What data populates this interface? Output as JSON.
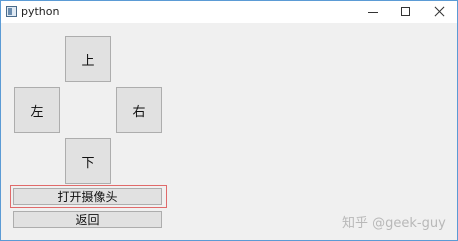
{
  "window": {
    "title": "python",
    "controls": {
      "minimize": "minimize",
      "maximize": "maximize",
      "close": "close"
    }
  },
  "direction_buttons": {
    "up": "上",
    "left": "左",
    "right": "右",
    "down": "下"
  },
  "actions": {
    "open_camera": "打开摄像头",
    "back": "返回"
  },
  "watermark": "知乎 @geek-guy"
}
